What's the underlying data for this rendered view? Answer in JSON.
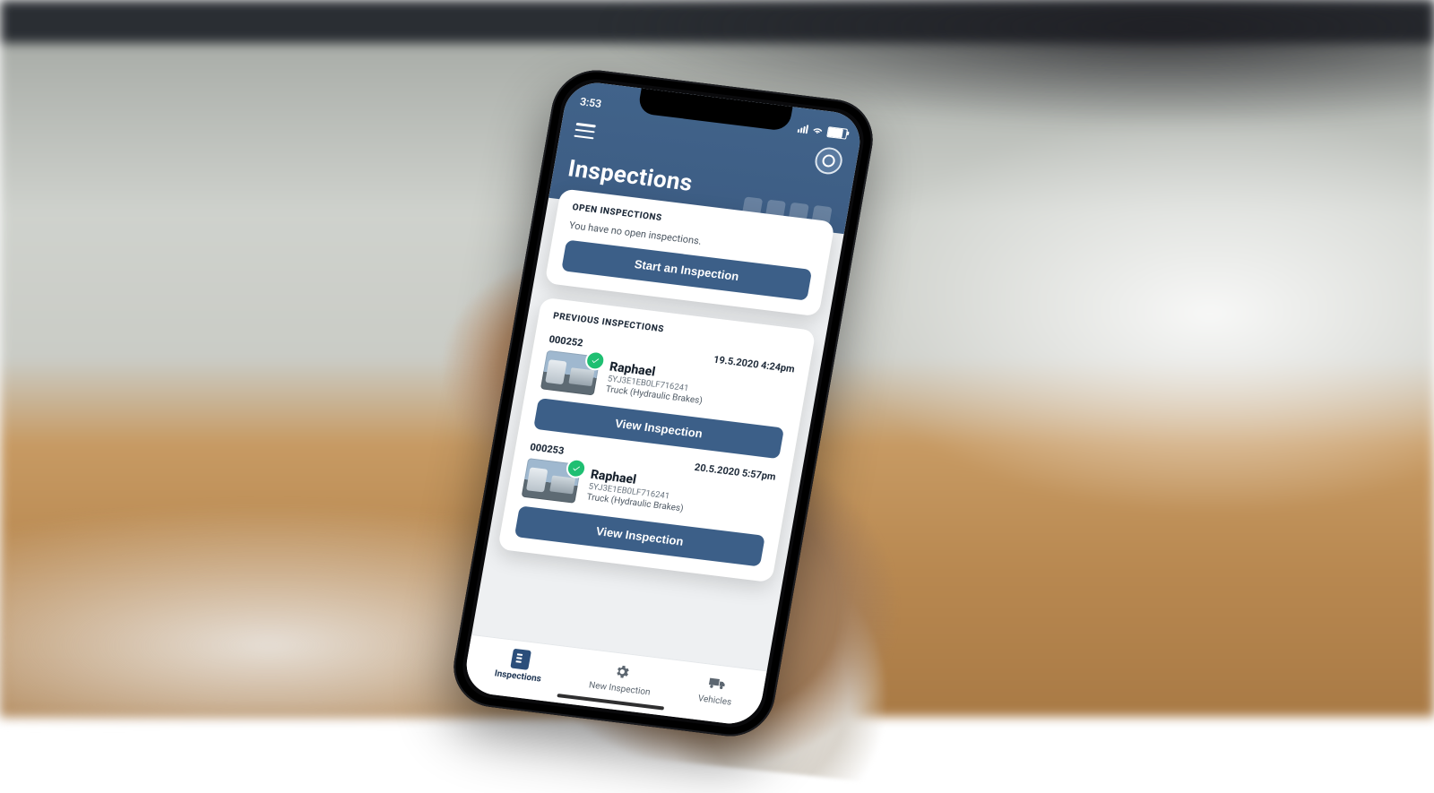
{
  "status": {
    "time": "3:53"
  },
  "header": {
    "title": "Inspections",
    "menu_icon": "menu-icon",
    "action_icon": "target-icon"
  },
  "open": {
    "section_title": "OPEN INSPECTIONS",
    "empty_text": "You have no open inspections.",
    "start_label": "Start an Inspection"
  },
  "previous": {
    "section_title": "PREVIOUS INSPECTIONS",
    "view_label": "View Inspection",
    "items": [
      {
        "id": "000252",
        "date": "19.5.2020 4:24pm",
        "name": "Raphael",
        "vin": "5YJ3E1EB0LF716241",
        "type": "Truck (Hydraulic Brakes)",
        "status_icon": "check-icon"
      },
      {
        "id": "000253",
        "date": "20.5.2020 5:57pm",
        "name": "Raphael",
        "vin": "5YJ3E1EB0LF716241",
        "type": "Truck (Hydraulic Brakes)",
        "status_icon": "check-icon"
      }
    ]
  },
  "tabs": {
    "inspections": "Inspections",
    "new_inspection": "New Inspection",
    "vehicles": "Vehicles"
  },
  "colors": {
    "brand": "#3d5d84",
    "button": "#3c5f88",
    "success": "#1fbf72"
  }
}
